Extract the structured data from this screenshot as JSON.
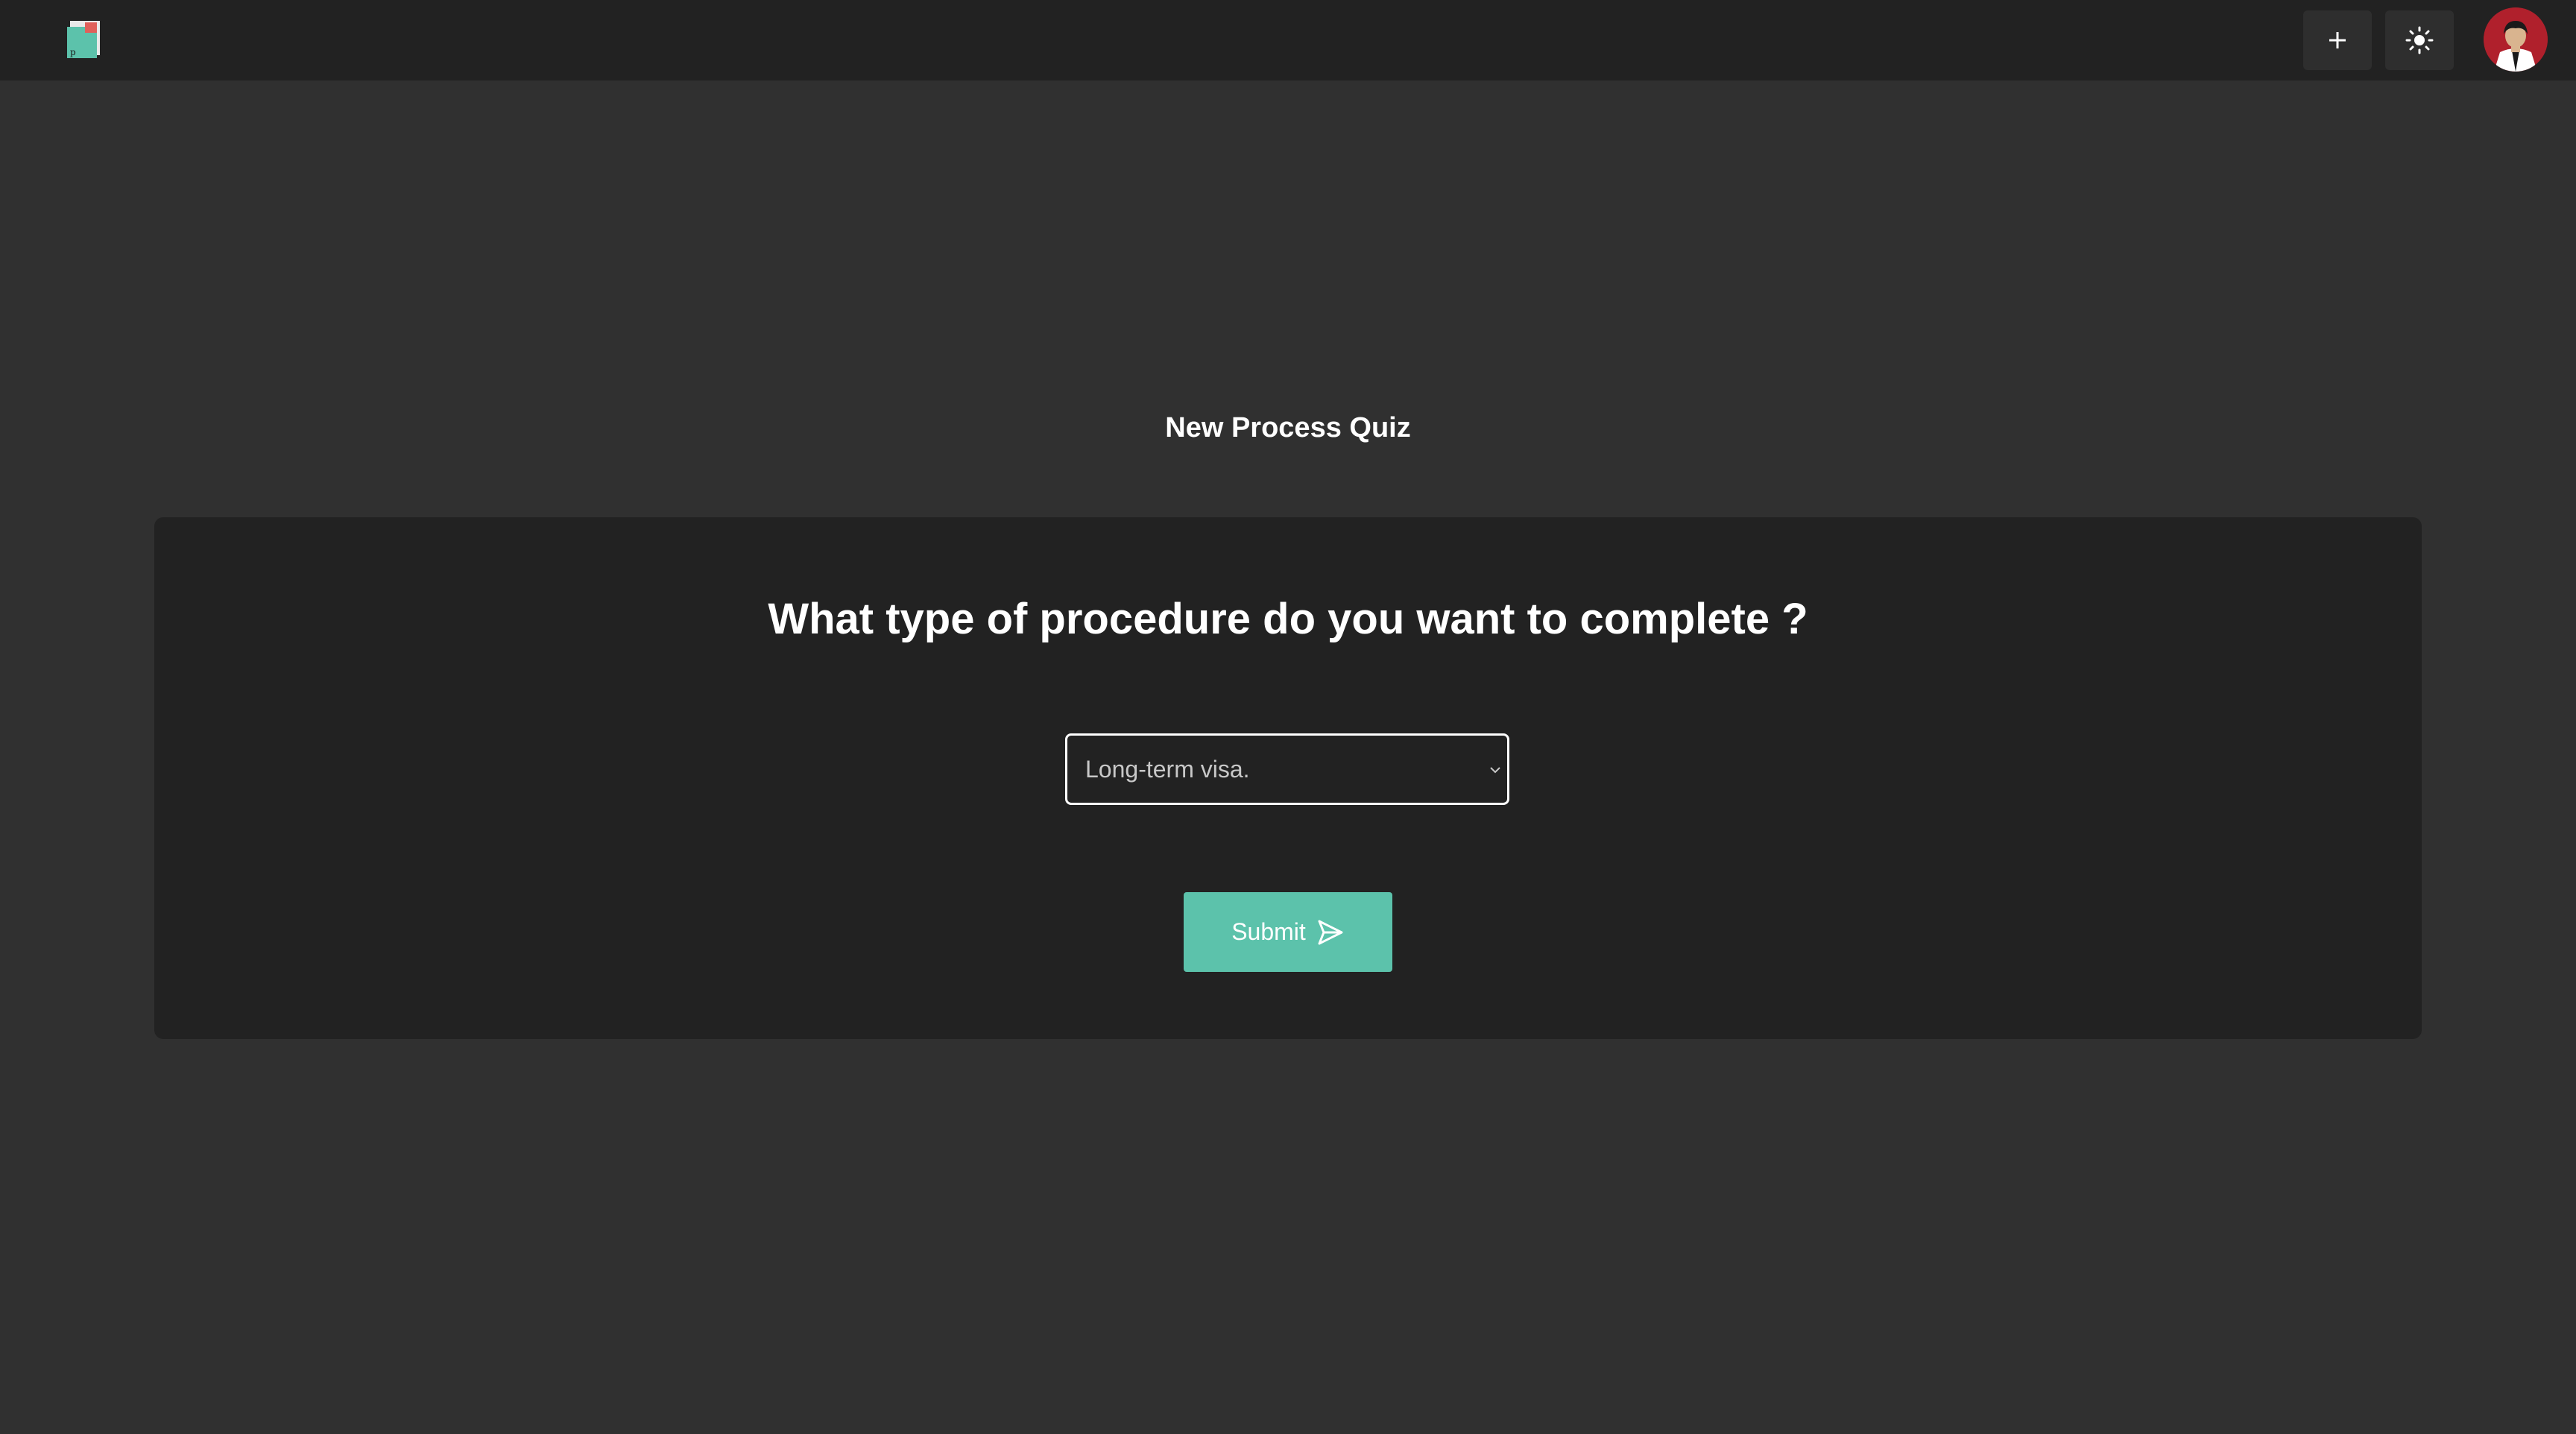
{
  "header": {
    "logo_icon": "app-logo-icon",
    "add_icon": "plus-icon",
    "theme_icon": "sun-icon",
    "avatar_icon": "user-avatar"
  },
  "page": {
    "title": "New Process Quiz"
  },
  "quiz": {
    "question": "What type of procedure do you want to complete ?",
    "select": {
      "value": "Long-term visa.",
      "icon": "chevron-down-icon"
    },
    "submit": {
      "label": "Submit",
      "icon": "send-icon"
    }
  },
  "colors": {
    "background": "#303030",
    "surface": "#222222",
    "accent": "#5cc2ab",
    "avatar_bg": "#b0202c"
  }
}
